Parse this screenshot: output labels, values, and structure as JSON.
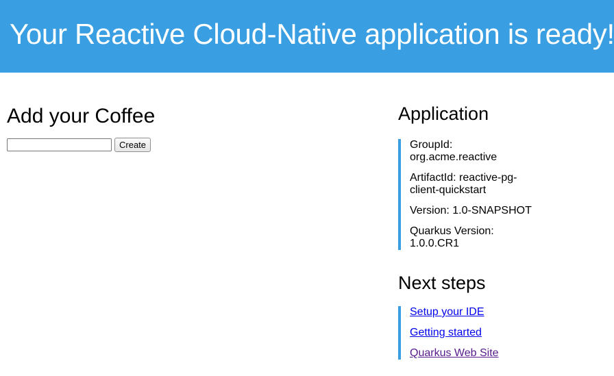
{
  "banner": {
    "title": "Your Reactive Cloud-Native application is ready!",
    "background_color": "#3a9fe2"
  },
  "coffee_form": {
    "heading": "Add your Coffee",
    "input_value": "",
    "input_placeholder": "",
    "create_label": "Create"
  },
  "application": {
    "heading": "Application",
    "items": [
      {
        "label": "GroupId: org.acme.reactive"
      },
      {
        "label": "ArtifactId: reactive-pg-client-quickstart"
      },
      {
        "label": "Version: 1.0-SNAPSHOT"
      },
      {
        "label": "Quarkus Version: 1.0.0.CR1"
      }
    ],
    "accent_color": "#3a9fe2"
  },
  "next_steps": {
    "heading": "Next steps",
    "links": [
      {
        "label": "Setup your IDE"
      },
      {
        "label": "Getting started"
      },
      {
        "label": "Quarkus Web Site"
      }
    ],
    "link_color": "#0000ee",
    "visited_link_color": "#551a8b"
  }
}
